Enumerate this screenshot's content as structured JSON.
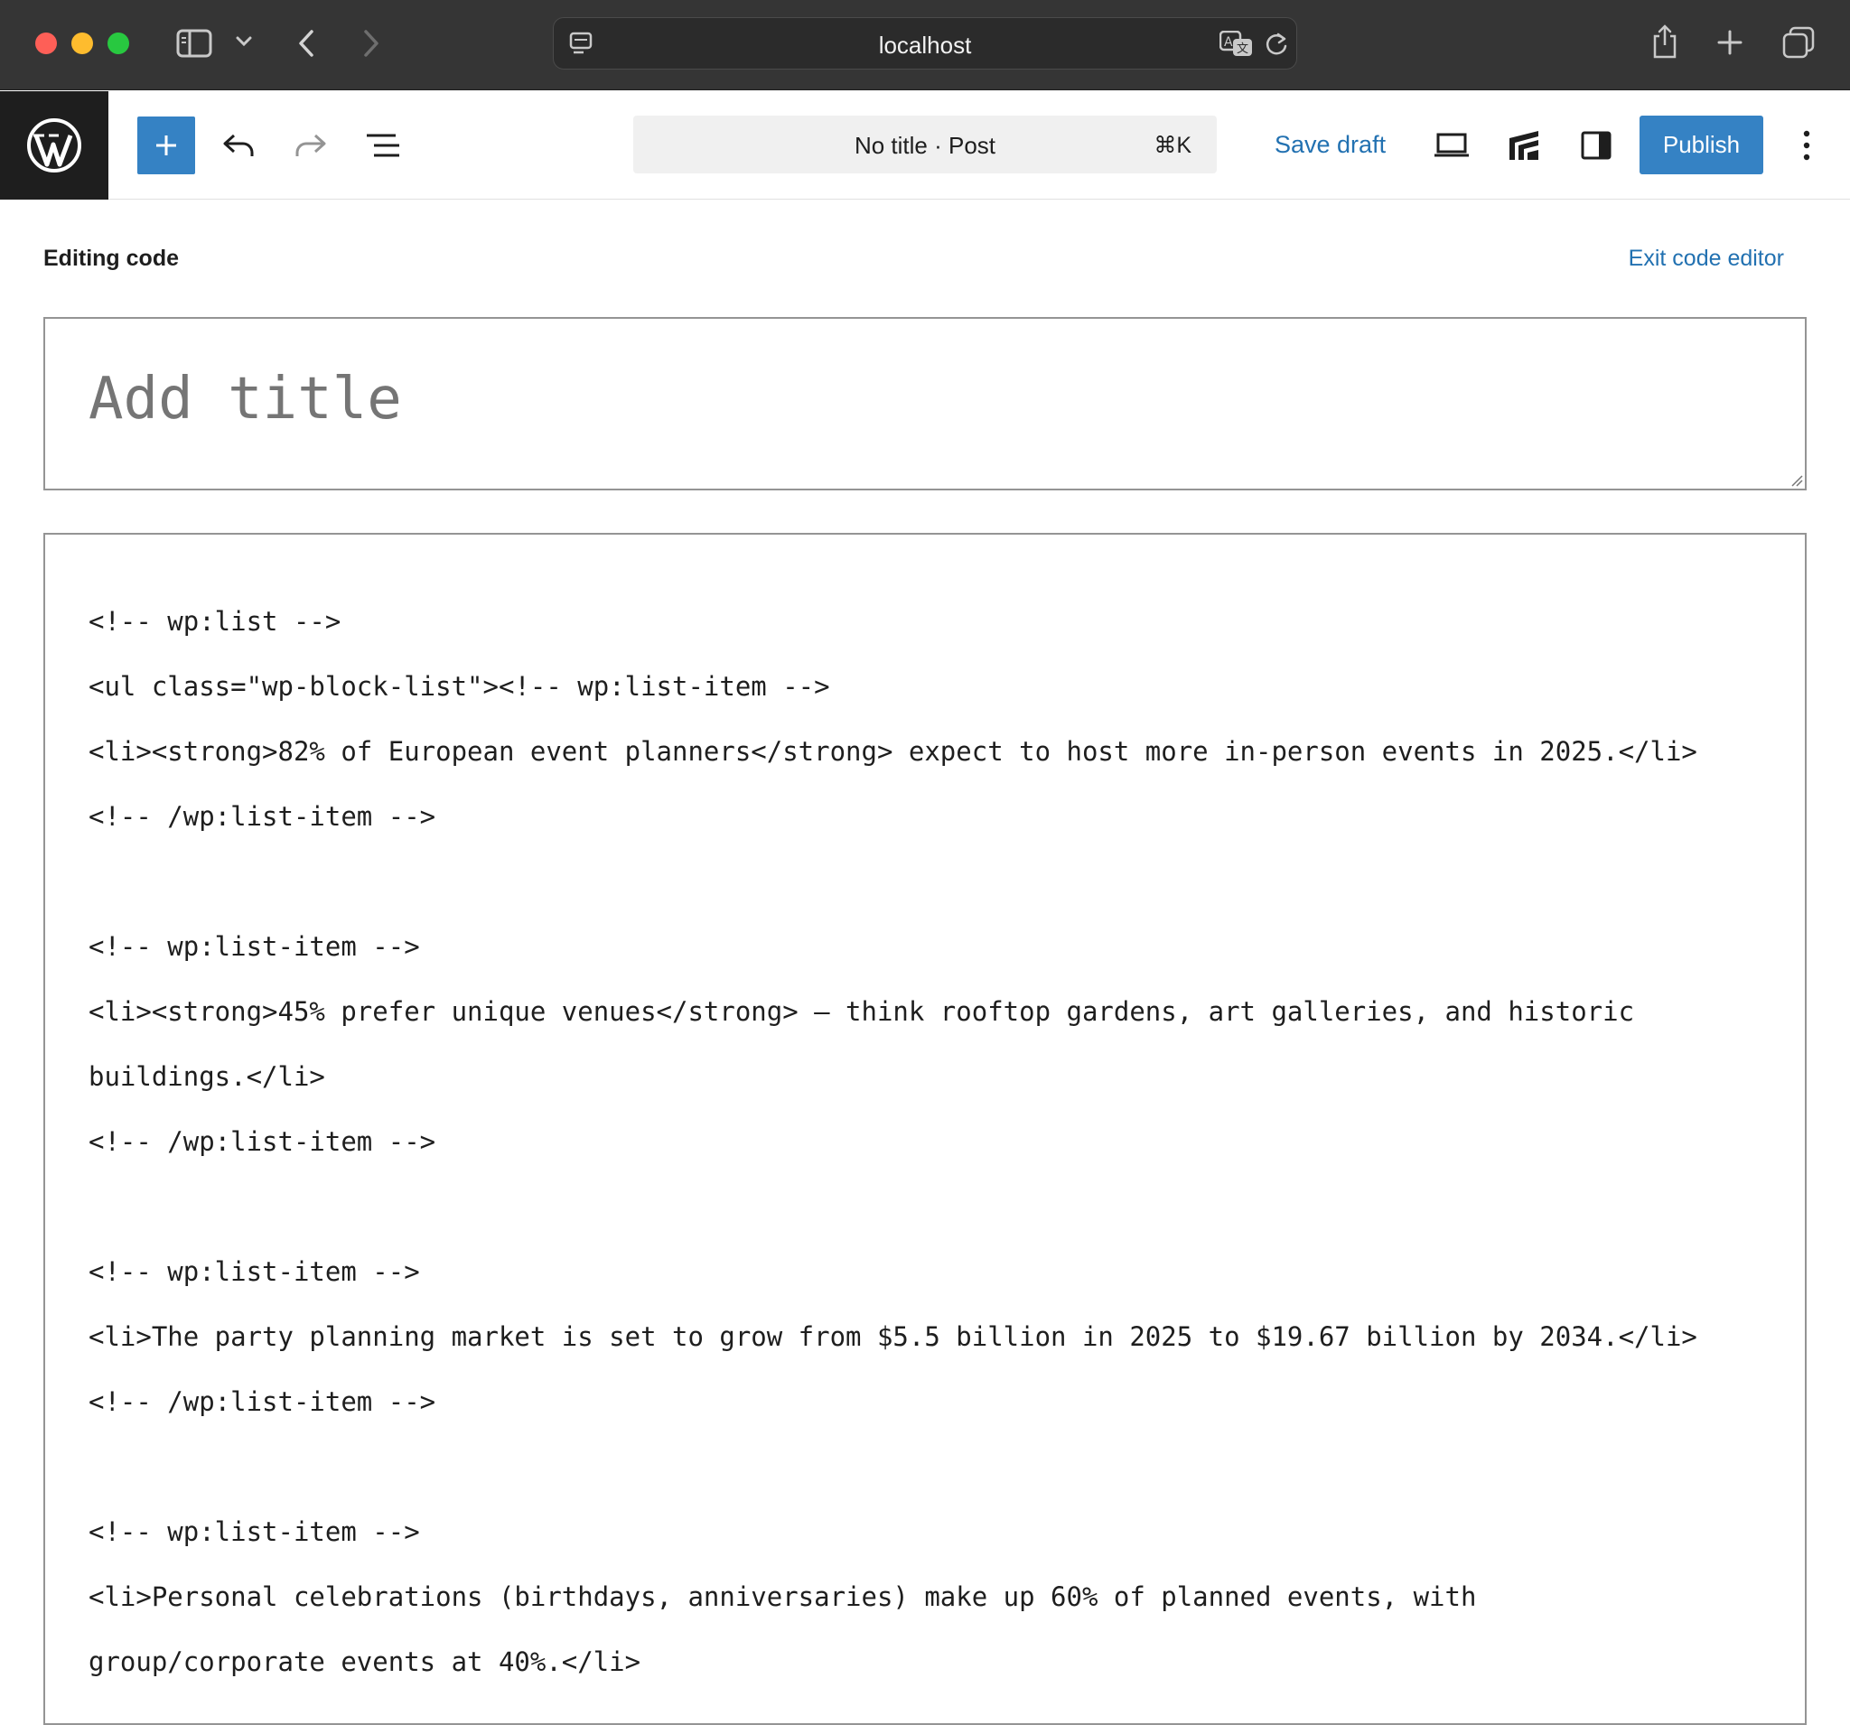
{
  "browser": {
    "url": "localhost",
    "icons": [
      "sidebar-toggle-icon",
      "chevron-down-icon",
      "back-arrow-icon",
      "forward-arrow-icon",
      "page-menu-icon",
      "translate-icon",
      "reload-icon",
      "share-icon",
      "new-tab-icon",
      "tab-overview-icon"
    ]
  },
  "toolbar": {
    "command_title": "No title · Post",
    "command_shortcut": "⌘K",
    "save_draft_label": "Save draft",
    "publish_label": "Publish",
    "icons": [
      "wordpress-logo-icon",
      "add-block-icon",
      "undo-icon",
      "redo-icon",
      "document-overview-icon",
      "preview-icon",
      "plugin-icon",
      "settings-sidebar-icon",
      "options-menu-icon"
    ],
    "colors": {
      "accent": "#3582c4",
      "link": "#2271b1",
      "logo_bg": "#1e1e1e"
    }
  },
  "editor": {
    "mode_label": "Editing code",
    "exit_label": "Exit code editor",
    "title_placeholder": "Add title",
    "code_lines": [
      "<!-- wp:list -->",
      "<ul class=\"wp-block-list\"><!-- wp:list-item -->",
      "<li><strong>82% of European event planners</strong> expect to host more in-person events in 2025.</li>",
      "<!-- /wp:list-item -->",
      "",
      "<!-- wp:list-item -->",
      "<li><strong>45% prefer unique venues</strong> – think rooftop gardens, art galleries, and historic",
      "buildings.</li>",
      "<!-- /wp:list-item -->",
      "",
      "<!-- wp:list-item -->",
      "<li>The party planning market is set to grow from $5.5 billion in 2025 to $19.67 billion by 2034.</li>",
      "<!-- /wp:list-item -->",
      "",
      "<!-- wp:list-item -->",
      "<li>Personal celebrations (birthdays, anniversaries) make up 60% of planned events, with",
      "group/corporate events at 40%.</li>"
    ]
  }
}
